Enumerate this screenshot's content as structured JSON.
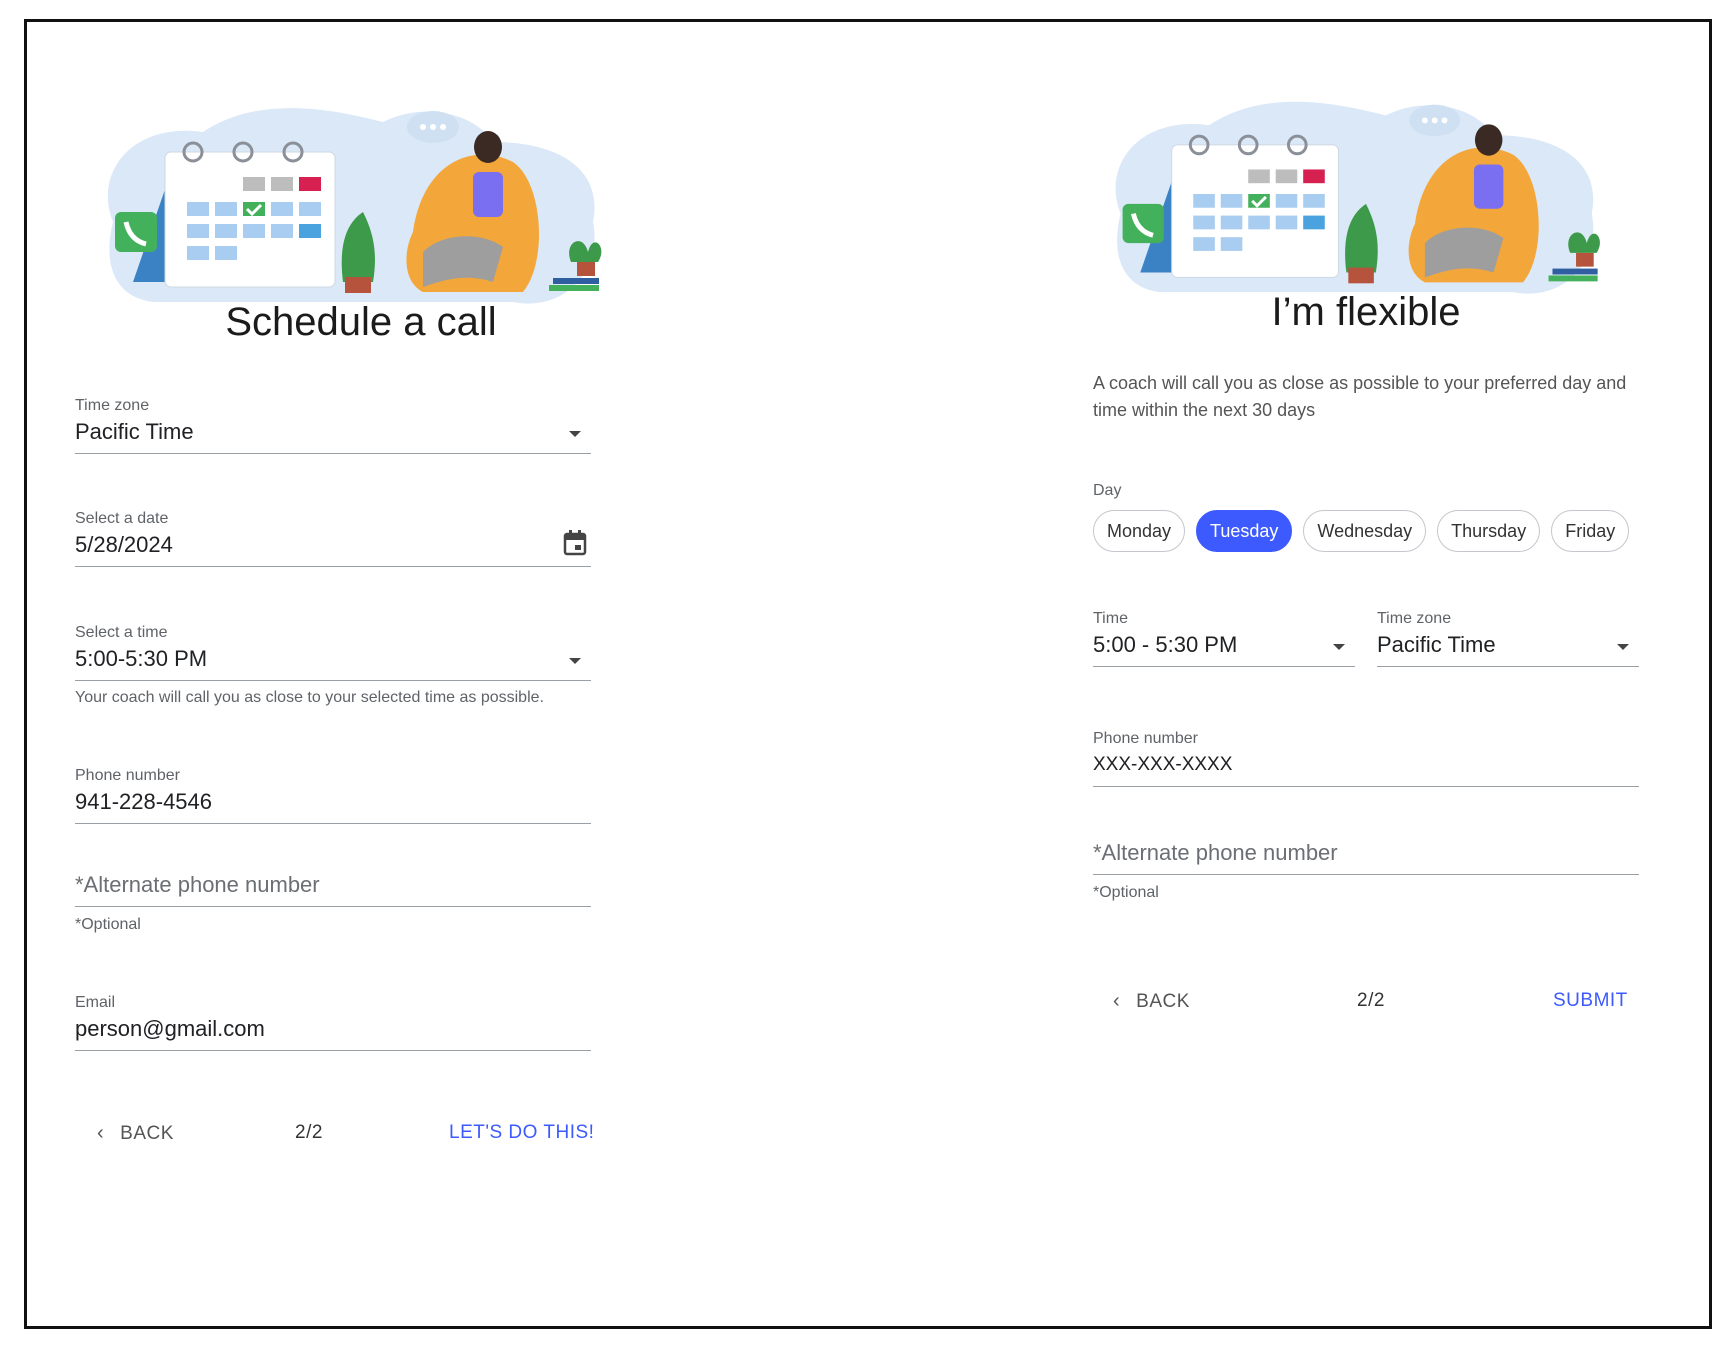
{
  "left": {
    "title": "Schedule a call",
    "timezone": {
      "label": "Time zone",
      "value": "Pacific Time"
    },
    "date": {
      "label": "Select a date",
      "value": "5/28/2024"
    },
    "time": {
      "label": "Select a time",
      "value": "5:00-5:30 PM",
      "helper": "Your coach will call you as close to your selected time as possible."
    },
    "phone": {
      "label": "Phone number",
      "value": "941-228-4546"
    },
    "alt_phone": {
      "placeholder": "*Alternate phone number",
      "helper": "*Optional"
    },
    "email": {
      "label": "Email",
      "value": "person@gmail.com"
    },
    "nav": {
      "back": "BACK",
      "step": "2/2",
      "cta": "LET'S DO THIS!"
    }
  },
  "right": {
    "title": "I’m flexible",
    "description": "A coach will call you as close as possible to your preferred day and time within the next 30 days",
    "day": {
      "label": "Day",
      "options": [
        "Monday",
        "Tuesday",
        "Wednesday",
        "Thursday",
        "Friday"
      ],
      "selected": "Tuesday"
    },
    "time": {
      "label": "Time",
      "value": "5:00 - 5:30 PM"
    },
    "timezone": {
      "label": "Time zone",
      "value": "Pacific Time"
    },
    "phone": {
      "label": "Phone number",
      "value": "XXX-XXX-XXXX"
    },
    "alt_phone": {
      "placeholder": "*Alternate phone number",
      "helper": "*Optional"
    },
    "nav": {
      "back": "BACK",
      "step": "2/2",
      "cta": "SUBMIT"
    }
  },
  "colors": {
    "accent": "#3d5afe",
    "divider": "#9aa0a6"
  },
  "icons": [
    "dropdown-caret-icon",
    "calendar-icon",
    "chevron-left-icon",
    "phone-icon",
    "checkmark-icon"
  ]
}
